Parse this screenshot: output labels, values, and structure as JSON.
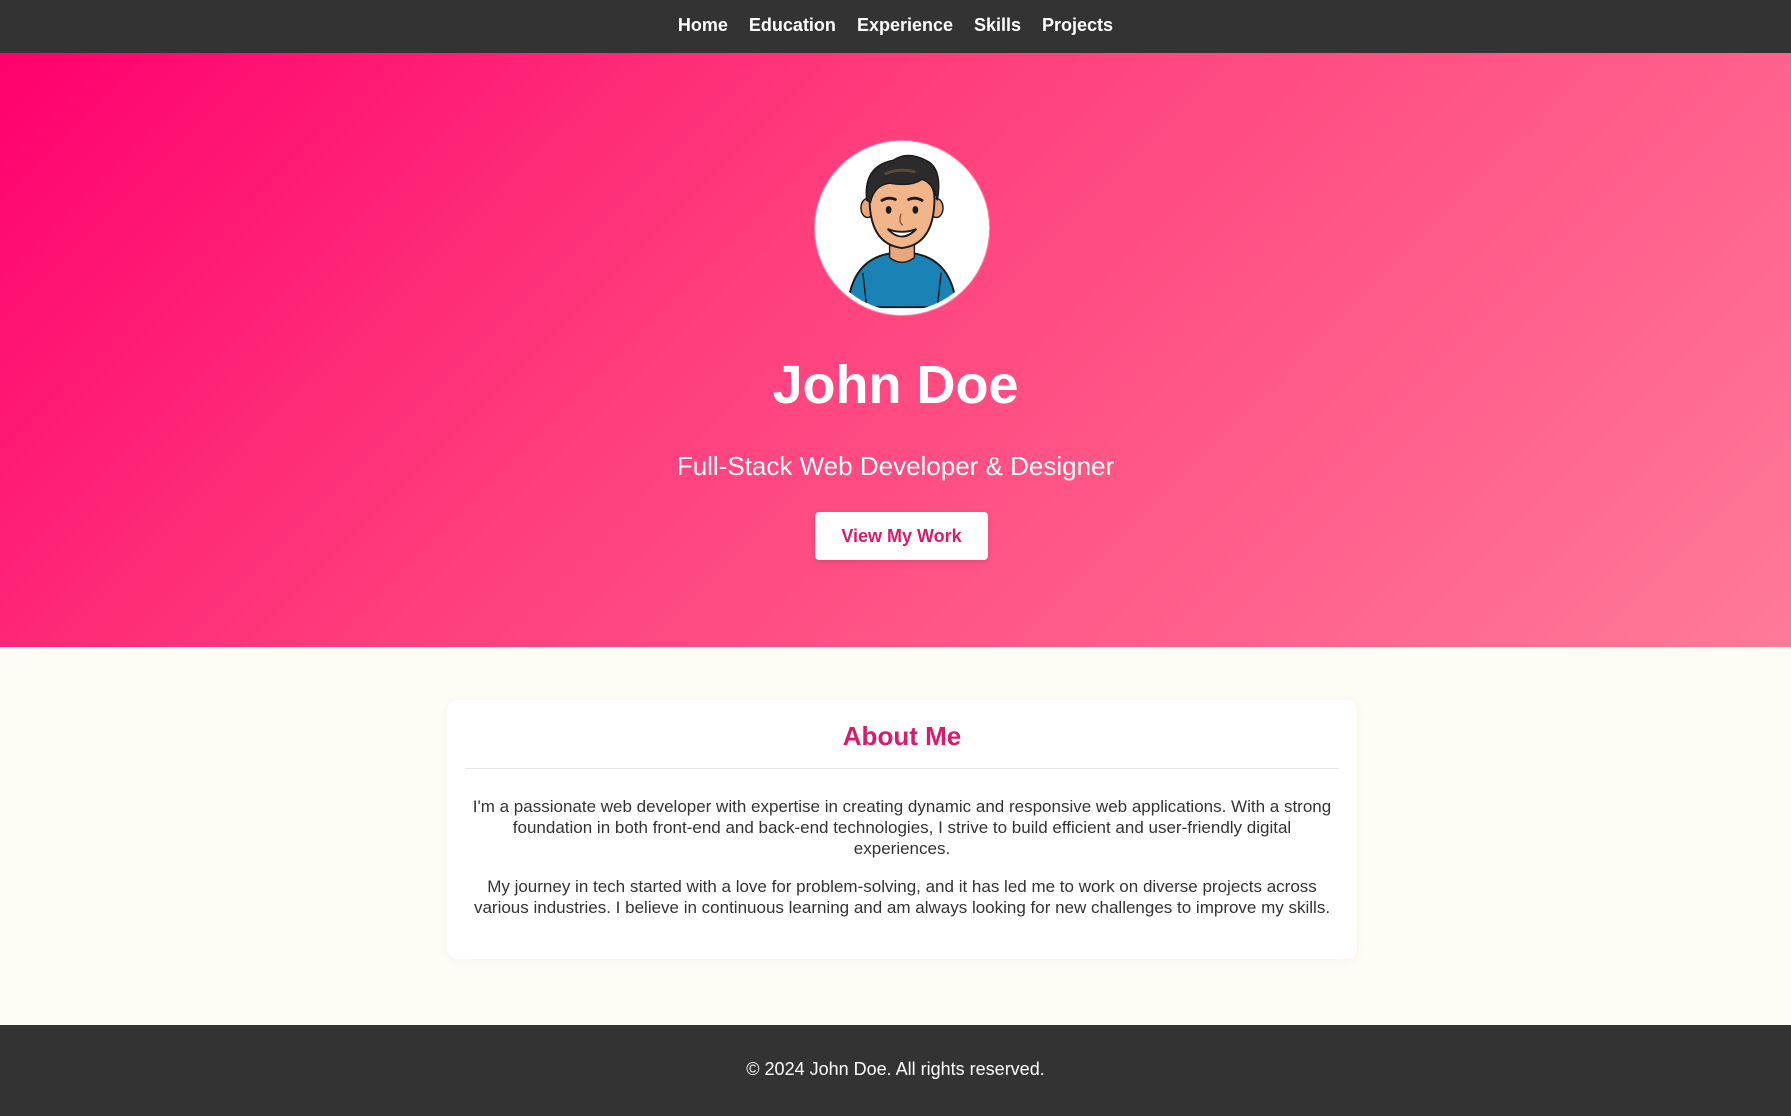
{
  "nav": {
    "items": [
      {
        "label": "Home"
      },
      {
        "label": "Education"
      },
      {
        "label": "Experience"
      },
      {
        "label": "Skills"
      },
      {
        "label": "Projects"
      }
    ]
  },
  "hero": {
    "name": "John Doe",
    "subtitle": "Full-Stack Web Developer & Designer",
    "cta_label": "View My Work",
    "avatar_icon": "avatar-icon"
  },
  "about": {
    "title": "About Me",
    "paragraphs": [
      "I'm a passionate web developer with expertise in creating dynamic and responsive web applications. With a strong foundation in both front-end and back-end technologies, I strive to build efficient and user-friendly digital experiences.",
      "My journey in tech started with a love for problem-solving, and it has led me to work on diverse projects across various industries. I believe in continuous learning and am always looking for new challenges to improve my skills."
    ]
  },
  "footer": {
    "copyright": "© 2024 John Doe. All rights reserved."
  },
  "colors": {
    "nav_bg": "#333333",
    "hero_gradient_start": "#ff006e",
    "hero_gradient_end": "#ff7a98",
    "accent": "#d81b6a",
    "page_bg": "#fffbf5",
    "footer_bg": "#333333"
  }
}
